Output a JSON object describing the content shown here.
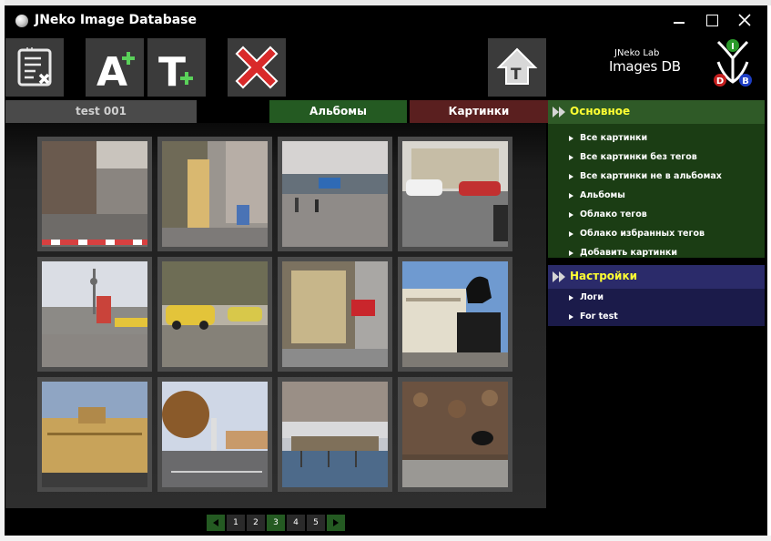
{
  "window": {
    "title": "JNeko Image Database"
  },
  "toolbar": {
    "buttons": [
      {
        "name": "edit-selection",
        "icon": "checklist-x-icon"
      },
      {
        "name": "add-album",
        "icon": "letter-a-plus-icon"
      },
      {
        "name": "add-tag",
        "icon": "letter-t-plus-icon"
      },
      {
        "name": "delete",
        "icon": "red-x-icon"
      },
      {
        "name": "tag-upload",
        "icon": "tag-arrow-icon"
      }
    ]
  },
  "logo": {
    "line1": "JNeko Lab",
    "line2": "Images DB",
    "letters": [
      "I",
      "D",
      "B"
    ]
  },
  "tabs": {
    "album_name": "test 001",
    "albums": "Альбомы",
    "pictures": "Картинки"
  },
  "gallery": {
    "thumbnails": [
      "street-construction-photo",
      "narrow-street-photo",
      "plaza-photo",
      "parked-cars-photo",
      "tv-tower-street-photo",
      "trabant-cars-photo",
      "shopfront-photo",
      "equestrian-statue-photo",
      "palace-building-photo",
      "autumn-square-photo",
      "river-pier-photo",
      "leaves-pavement-photo"
    ]
  },
  "pager": {
    "pages": [
      "1",
      "2",
      "3",
      "4",
      "5"
    ],
    "current": "3"
  },
  "sidebar": {
    "main": {
      "title": "Основное",
      "items": [
        "Все картинки",
        "Все картинки без тегов",
        "Все картинки не в альбомах",
        "Альбомы",
        "Облако тегов",
        "Облако избранных тегов",
        "Добавить картинки"
      ]
    },
    "settings": {
      "title": "Настройки",
      "items": [
        "Логи",
        "For test"
      ]
    }
  },
  "colors": {
    "accent_green": "#245a22",
    "accent_red": "#5a1f1f",
    "panel_title": "#ffff33",
    "settings_panel": "#1b1b4a",
    "main_panel": "#1b3d14"
  }
}
